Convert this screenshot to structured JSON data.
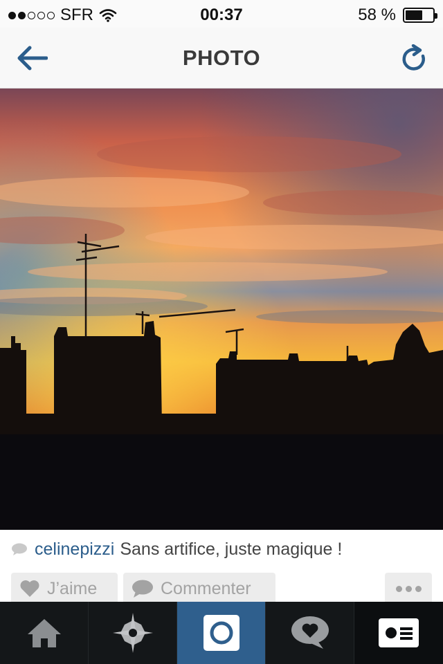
{
  "status_bar": {
    "carrier": "SFR",
    "signal_bars_filled": 2,
    "signal_bars_total": 5,
    "time": "00:37",
    "battery_percent": "58 %",
    "battery_level": 0.58
  },
  "nav": {
    "title": "PHOTO",
    "back_icon": "arrow-left-icon",
    "refresh_icon": "refresh-icon",
    "accent_color": "#2b5d8b"
  },
  "post": {
    "photo_subject": "sunset sky over rooftops with antennas",
    "username": "celinepizzi",
    "caption": "Sans artifice, juste magique !"
  },
  "actions": {
    "like_label": "J’aime",
    "comment_label": "Commenter",
    "like_icon": "heart-icon",
    "comment_icon": "speech-bubble-icon",
    "more_icon": "more-dots-icon"
  },
  "tab_bar": {
    "items": [
      {
        "icon": "home-icon",
        "active": false
      },
      {
        "icon": "explore-star-icon",
        "active": false
      },
      {
        "icon": "camera-icon",
        "active": true
      },
      {
        "icon": "activity-heart-bubble-icon",
        "active": false
      },
      {
        "icon": "profile-card-icon",
        "active": false
      }
    ],
    "active_color": "#2f5f8d"
  }
}
